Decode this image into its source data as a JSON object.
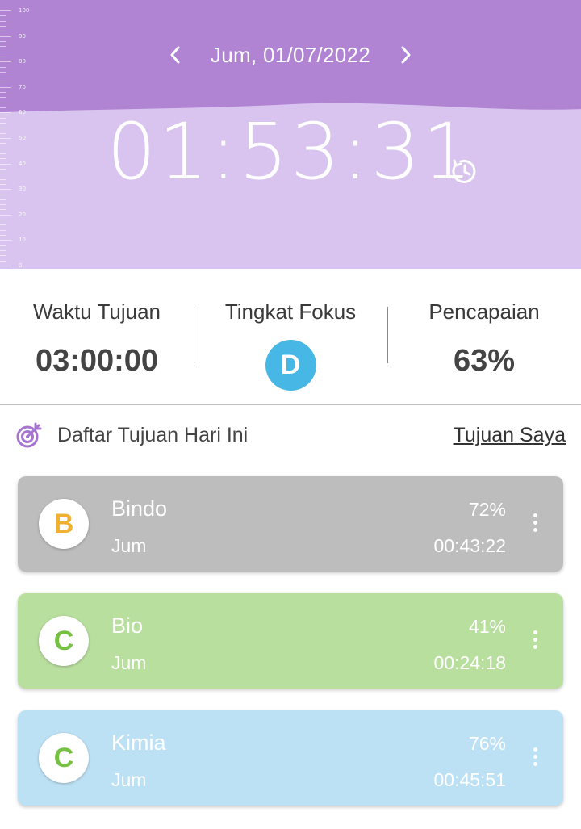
{
  "header": {
    "date": "Jum, 01/07/2022",
    "timer": "01:53:31",
    "ruler_labels": [
      "100",
      "90",
      "80",
      "70",
      "60",
      "50",
      "40",
      "30",
      "20",
      "10",
      "0"
    ],
    "level_percent": 62,
    "colors": {
      "top": "#b083d3",
      "bottom": "#d9c4f0"
    },
    "icons": {
      "prev": "chevron-left-icon",
      "next": "chevron-right-icon",
      "clock": "clock-icon"
    }
  },
  "stats": {
    "target_label": "Waktu Tujuan",
    "target_value": "03:00:00",
    "focus_label": "Tingkat Fokus",
    "focus_grade": "D",
    "focus_color": "#47b8e6",
    "achievement_label": "Pencapaian",
    "achievement_value": "63%"
  },
  "list": {
    "icon": "target-icon",
    "title": "Daftar Tujuan Hari Ini",
    "link": "Tujuan Saya"
  },
  "goals": [
    {
      "grade": "B",
      "grade_color": "#f0b030",
      "name": "Bindo",
      "day": "Jum",
      "percent": "72%",
      "time": "00:43:22",
      "bg": "#bdbdbd"
    },
    {
      "grade": "C",
      "grade_color": "#76c043",
      "name": "Bio",
      "day": "Jum",
      "percent": "41%",
      "time": "00:24:18",
      "bg": "#b9df9f"
    },
    {
      "grade": "C",
      "grade_color": "#76c043",
      "name": "Kimia",
      "day": "Jum",
      "percent": "76%",
      "time": "00:45:51",
      "bg": "#bde1f4"
    }
  ]
}
